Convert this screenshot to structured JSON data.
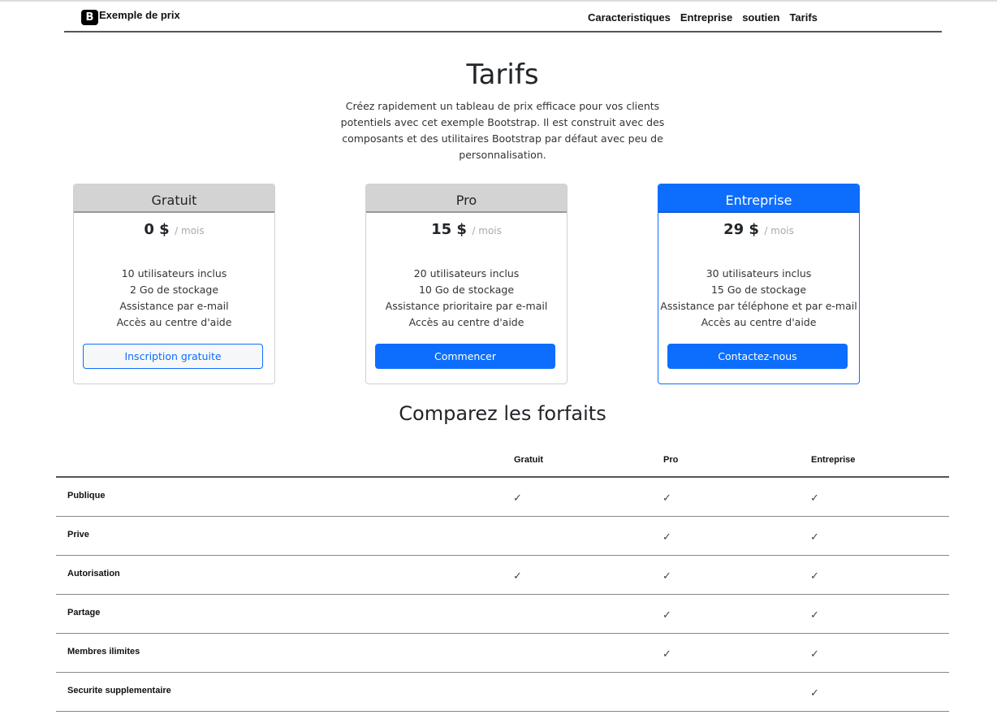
{
  "header": {
    "brand_logo": "B",
    "brand_name": "Exemple de prix",
    "nav": [
      "Caracteristiques",
      "Entreprise",
      "soutien",
      "Tarifs"
    ]
  },
  "hero": {
    "title": "Tarifs",
    "lead": "Créez rapidement un tableau de prix efficace pour vos clients potentiels avec cet exemple Bootstrap. Il est construit avec des composants et des utilitaires Bootstrap par défaut avec peu de personnalisation."
  },
  "plans": [
    {
      "name": "Gratuit",
      "price": "0 $",
      "period": "/ mois",
      "features": [
        "10 utilisateurs inclus",
        "2 Go de stockage",
        "Assistance par e-mail",
        "Accès au centre d'aide"
      ],
      "button": "Inscription gratuite"
    },
    {
      "name": "Pro",
      "price": "15 $",
      "period": "/ mois",
      "features": [
        "20 utilisateurs inclus",
        "10 Go de stockage",
        "Assistance prioritaire par e-mail",
        "Accès au centre d'aide"
      ],
      "button": "Commencer"
    },
    {
      "name": "Entreprise",
      "price": "29 $",
      "period": "/ mois",
      "features": [
        "30 utilisateurs inclus",
        "15 Go de stockage",
        "Assistance par téléphone et par e-mail",
        "Accès au centre d'aide"
      ],
      "button": "Contactez-nous"
    }
  ],
  "compare": {
    "title": "Comparez les forfaits",
    "columns": [
      "Gratuit",
      "Pro",
      "Entreprise"
    ],
    "check_glyph": "✓",
    "rows": [
      {
        "label": "Publique",
        "gratuit": "✓",
        "pro": "✓",
        "entreprise": "✓"
      },
      {
        "label": "Prive",
        "gratuit": "",
        "pro": "✓",
        "entreprise": "✓"
      },
      {
        "label": "Autorisation",
        "gratuit": "✓",
        "pro": "✓",
        "entreprise": "✓"
      },
      {
        "label": "Partage",
        "gratuit": "",
        "pro": "✓",
        "entreprise": "✓"
      },
      {
        "label": "Membres ilimites",
        "gratuit": "",
        "pro": "✓",
        "entreprise": "✓"
      },
      {
        "label": "Securite supplementaire",
        "gratuit": "",
        "pro": "",
        "entreprise": "✓"
      }
    ]
  },
  "colors": {
    "primary": "#0d6efd",
    "card_header": "#d3d3d3",
    "text": "#212529"
  }
}
